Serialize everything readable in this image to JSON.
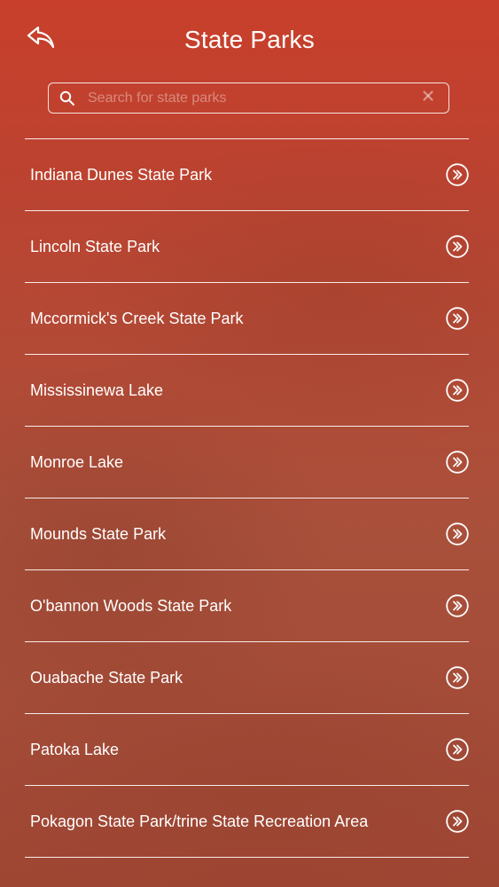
{
  "header": {
    "title": "State Parks",
    "back_icon": "back-arrow-icon"
  },
  "search": {
    "placeholder": "Search for state parks",
    "value": "",
    "icon": "search-icon",
    "clear_icon": "clear-icon"
  },
  "parks": [
    {
      "label": "Indiana Dunes State Park"
    },
    {
      "label": "Lincoln State Park"
    },
    {
      "label": "Mccormick's Creek State Park"
    },
    {
      "label": "Mississinewa Lake"
    },
    {
      "label": "Monroe Lake"
    },
    {
      "label": "Mounds State Park"
    },
    {
      "label": "O'bannon Woods State Park"
    },
    {
      "label": "Ouabache State Park"
    },
    {
      "label": "Patoka Lake"
    },
    {
      "label": "Pokagon State Park/trine State Recreation Area"
    }
  ],
  "item_icon": "double-chevron-right-circle-icon",
  "colors": {
    "background_top": "#c8402b",
    "background_bottom": "#9f4633",
    "foreground": "#ffffff"
  }
}
